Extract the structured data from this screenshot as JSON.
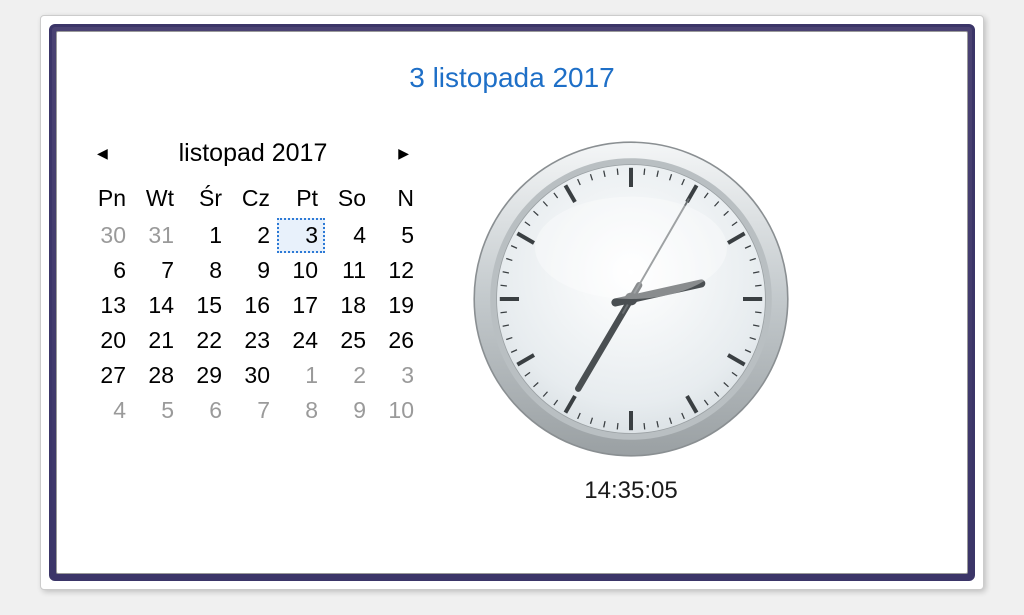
{
  "title": "3 listopada 2017",
  "calendar": {
    "month_label": "listopad 2017",
    "day_headers": [
      "Pn",
      "Wt",
      "Śr",
      "Cz",
      "Pt",
      "So",
      "N"
    ],
    "weeks": [
      [
        {
          "d": "30",
          "out": true
        },
        {
          "d": "31",
          "out": true
        },
        {
          "d": "1"
        },
        {
          "d": "2"
        },
        {
          "d": "3",
          "selected": true
        },
        {
          "d": "4"
        },
        {
          "d": "5"
        }
      ],
      [
        {
          "d": "6"
        },
        {
          "d": "7"
        },
        {
          "d": "8"
        },
        {
          "d": "9"
        },
        {
          "d": "10"
        },
        {
          "d": "11"
        },
        {
          "d": "12"
        }
      ],
      [
        {
          "d": "13"
        },
        {
          "d": "14"
        },
        {
          "d": "15"
        },
        {
          "d": "16"
        },
        {
          "d": "17"
        },
        {
          "d": "18"
        },
        {
          "d": "19"
        }
      ],
      [
        {
          "d": "20"
        },
        {
          "d": "21"
        },
        {
          "d": "22"
        },
        {
          "d": "23"
        },
        {
          "d": "24"
        },
        {
          "d": "25"
        },
        {
          "d": "26"
        }
      ],
      [
        {
          "d": "27"
        },
        {
          "d": "28"
        },
        {
          "d": "29"
        },
        {
          "d": "30"
        },
        {
          "d": "1",
          "out": true
        },
        {
          "d": "2",
          "out": true
        },
        {
          "d": "3",
          "out": true
        }
      ],
      [
        {
          "d": "4",
          "out": true
        },
        {
          "d": "5",
          "out": true
        },
        {
          "d": "6",
          "out": true
        },
        {
          "d": "7",
          "out": true
        },
        {
          "d": "8",
          "out": true
        },
        {
          "d": "9",
          "out": true
        },
        {
          "d": "10",
          "out": true
        }
      ]
    ]
  },
  "clock": {
    "digital": "14:35:05",
    "hours": 14,
    "minutes": 35,
    "seconds": 5
  }
}
